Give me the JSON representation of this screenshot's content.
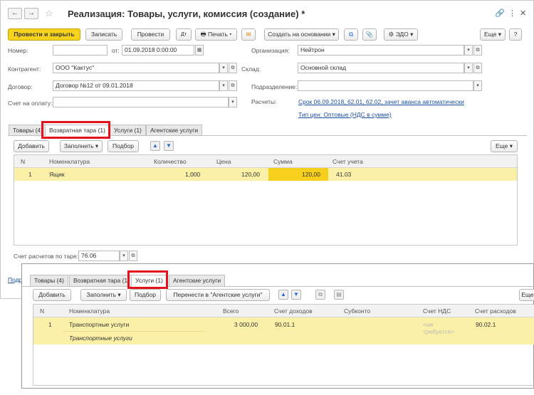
{
  "window": {
    "title": "Реализация: Товары, услуги, комиссия (создание)",
    "modified_mark": "*",
    "back": "←",
    "forward": "→",
    "star": "☆",
    "link_icon": "🔗",
    "more_icon": "⋮",
    "close_icon": "✕"
  },
  "toolbar": {
    "post_close": "Провести и закрыть",
    "save": "Записать",
    "post": "Провести",
    "print": "Печать",
    "create_based": "Создать на основании",
    "edo": "ЭДО",
    "more": "Еще",
    "help": "?"
  },
  "form": {
    "number_label": "Номер:",
    "number_value": "",
    "date_label": "от:",
    "date_value": "01.09.2018  0:00:00",
    "org_label": "Организация:",
    "org_value": "Нейтрон",
    "contractor_label": "Контрагент:",
    "contractor_value": "ООО \"Кактус\"",
    "warehouse_label": "Склад:",
    "warehouse_value": "Основной склад",
    "contract_label": "Договор:",
    "contract_value": "Договор №12 от 09.01.2018",
    "division_label": "Подразделение:",
    "division_value": "",
    "invoice_label": "Счет на оплату:",
    "invoice_value": "",
    "settlements_label": "Расчеты:",
    "settlements_link": "Срок 06.09.2018, 62.01, 62.02, зачет аванса автоматически",
    "price_type_link": "Тип цен: Оптовые (НДС в сумме)"
  },
  "tabs1": [
    "Товары (4)",
    "Возвратная тара (1)",
    "Услуги (1)",
    "Агентские услуги"
  ],
  "table1": {
    "add": "Добавить",
    "fill": "Заполнить",
    "pick": "Подбор",
    "more": "Еще",
    "columns": [
      "N",
      "Номенклатура",
      "Количество",
      "Цена",
      "Сумма",
      "Счет учета"
    ],
    "rows": [
      {
        "n": "1",
        "name": "Ящик",
        "qty": "1,000",
        "price": "120,00",
        "sum": "120,00",
        "account": "41.03"
      }
    ]
  },
  "tare_account": {
    "label": "Счет расчетов по таре:",
    "value": "76.06"
  },
  "cutoff_link": "Подр",
  "tabs2": [
    "Товары (4)",
    "Возвратная тара (1)",
    "Услуги (1)",
    "Агентские услуги"
  ],
  "table2": {
    "add": "Добавить",
    "fill": "Заполнить",
    "pick": "Подбор",
    "transfer": "Перенести в \"Агентские услуги\"",
    "more": "Еще",
    "columns": [
      "N",
      "Номенклатура",
      "Всего",
      "Счет доходов",
      "Субконто",
      "Счет НДС",
      "Счет расходов"
    ],
    "rows": [
      {
        "n": "1",
        "name": "Транспортные услуги",
        "content": "Транспортные услуги",
        "total": "3 000,00",
        "income": "90.01.1",
        "subconto": "",
        "vat": "<не требуется>",
        "expense": "90.02.1"
      }
    ]
  },
  "colors": {
    "accent": "#f7d31e",
    "row_highlight": "#fbf0a8",
    "cell_selected": "#f7cf1d",
    "link": "#1a4f9a",
    "callout": "#e2131d"
  }
}
